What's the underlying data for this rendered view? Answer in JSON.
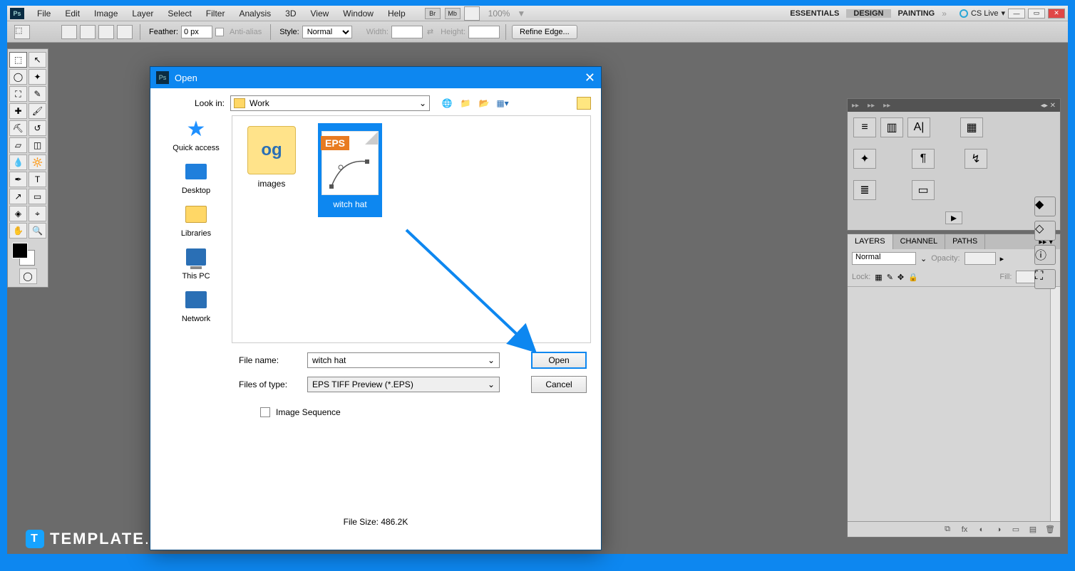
{
  "menubar": {
    "items": [
      "File",
      "Edit",
      "Image",
      "Layer",
      "Select",
      "Filter",
      "Analysis",
      "3D",
      "View",
      "Window",
      "Help"
    ],
    "zoom": "100%",
    "br": "Br",
    "mb": "Mb",
    "workspaces": [
      "ESSENTIALS",
      "DESIGN",
      "PAINTING"
    ],
    "cslive": "CS Live"
  },
  "options": {
    "feather_label": "Feather:",
    "feather_value": "0 px",
    "antialias": "Anti-alias",
    "style_label": "Style:",
    "style_value": "Normal",
    "width_label": "Width:",
    "height_label": "Height:",
    "refine": "Refine Edge..."
  },
  "dialog": {
    "title": "Open",
    "lookin_label": "Look in:",
    "lookin_value": "Work",
    "places": {
      "quick": "Quick access",
      "desktop": "Desktop",
      "libraries": "Libraries",
      "thispc": "This PC",
      "network": "Network"
    },
    "files": {
      "images": "images",
      "witchhat": "witch hat",
      "eps_badge": "EPS"
    },
    "filename_label": "File name:",
    "filename_value": "witch hat",
    "filetype_label": "Files of type:",
    "filetype_value": "EPS TIFF Preview (*.EPS)",
    "open_btn": "Open",
    "cancel_btn": "Cancel",
    "image_sequence": "Image Sequence",
    "filesize": "File Size: 486.2K"
  },
  "layers": {
    "tabs": [
      "LAYERS",
      "CHANNEL",
      "PATHS"
    ],
    "mode": "Normal",
    "opacity_label": "Opacity:",
    "lock_label": "Lock:",
    "fill_label": "Fill:"
  },
  "watermark": {
    "brand": "TEMPLATE",
    "suffix": ".NET",
    "icon": "T"
  }
}
